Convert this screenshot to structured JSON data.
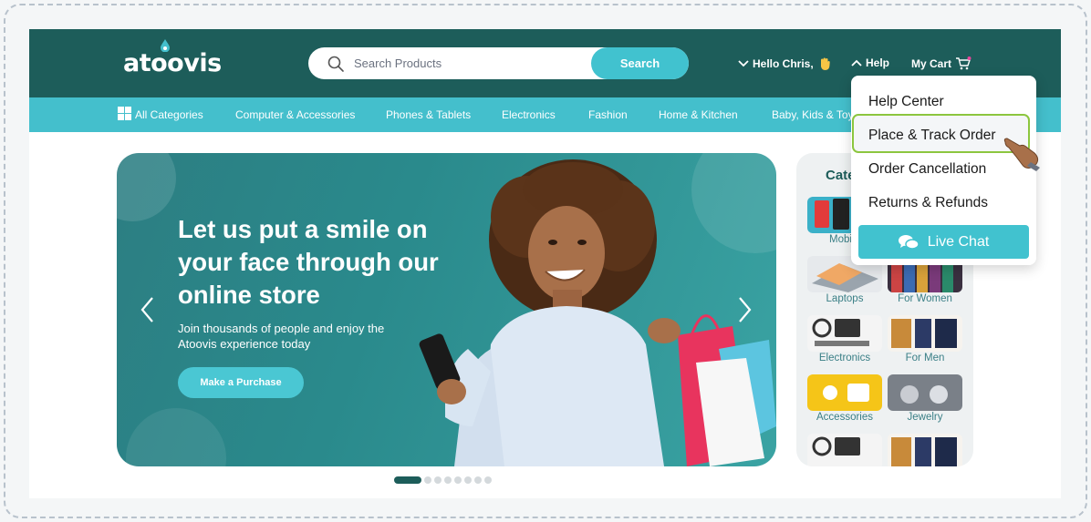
{
  "brand": {
    "logo_text": "atoovis"
  },
  "search": {
    "placeholder": "Search Products",
    "button_label": "Search"
  },
  "header": {
    "greeting": "Hello Chris,",
    "help_label": "Help",
    "cart_label": "My Cart"
  },
  "categories_bar": {
    "all_label": "All Categories",
    "items": [
      "Computer & Accessories",
      "Phones & Tablets",
      "Electronics",
      "Fashion",
      "Home & Kitchen",
      "Baby, Kids & Toys"
    ]
  },
  "hero": {
    "title": "Let us put a smile on your face through our online store",
    "subtitle": "Join thousands of people and enjoy the Atoovis experience today",
    "cta_label": "Make a Purchase",
    "slide_count": 8,
    "active_slide": 1
  },
  "category_panel": {
    "title": "Categories",
    "tiles": [
      {
        "label": "Mobile",
        "icon": "phones-image"
      },
      {
        "label": "",
        "icon": "tablets-image"
      },
      {
        "label": "Laptops",
        "icon": "laptops-image"
      },
      {
        "label": "For Women",
        "icon": "women-fashion-image"
      },
      {
        "label": "Electronics",
        "icon": "electronics-image"
      },
      {
        "label": "For Men",
        "icon": "men-fashion-image"
      },
      {
        "label": "Accessories",
        "icon": "accessories-image"
      },
      {
        "label": "Jewelry",
        "icon": "jewelry-image"
      },
      {
        "label": "",
        "icon": "electronics-image"
      },
      {
        "label": "",
        "icon": "men-fashion-image"
      }
    ]
  },
  "help_menu": {
    "items": [
      "Help Center",
      "Place & Track Order",
      "Order Cancellation",
      "Returns & Refunds"
    ],
    "highlighted": "Place & Track Order",
    "live_chat_label": "Live Chat"
  },
  "colors": {
    "primary_dark": "#1d5d5a",
    "accent": "#41c2cf",
    "highlight_border": "#8cc63f"
  }
}
